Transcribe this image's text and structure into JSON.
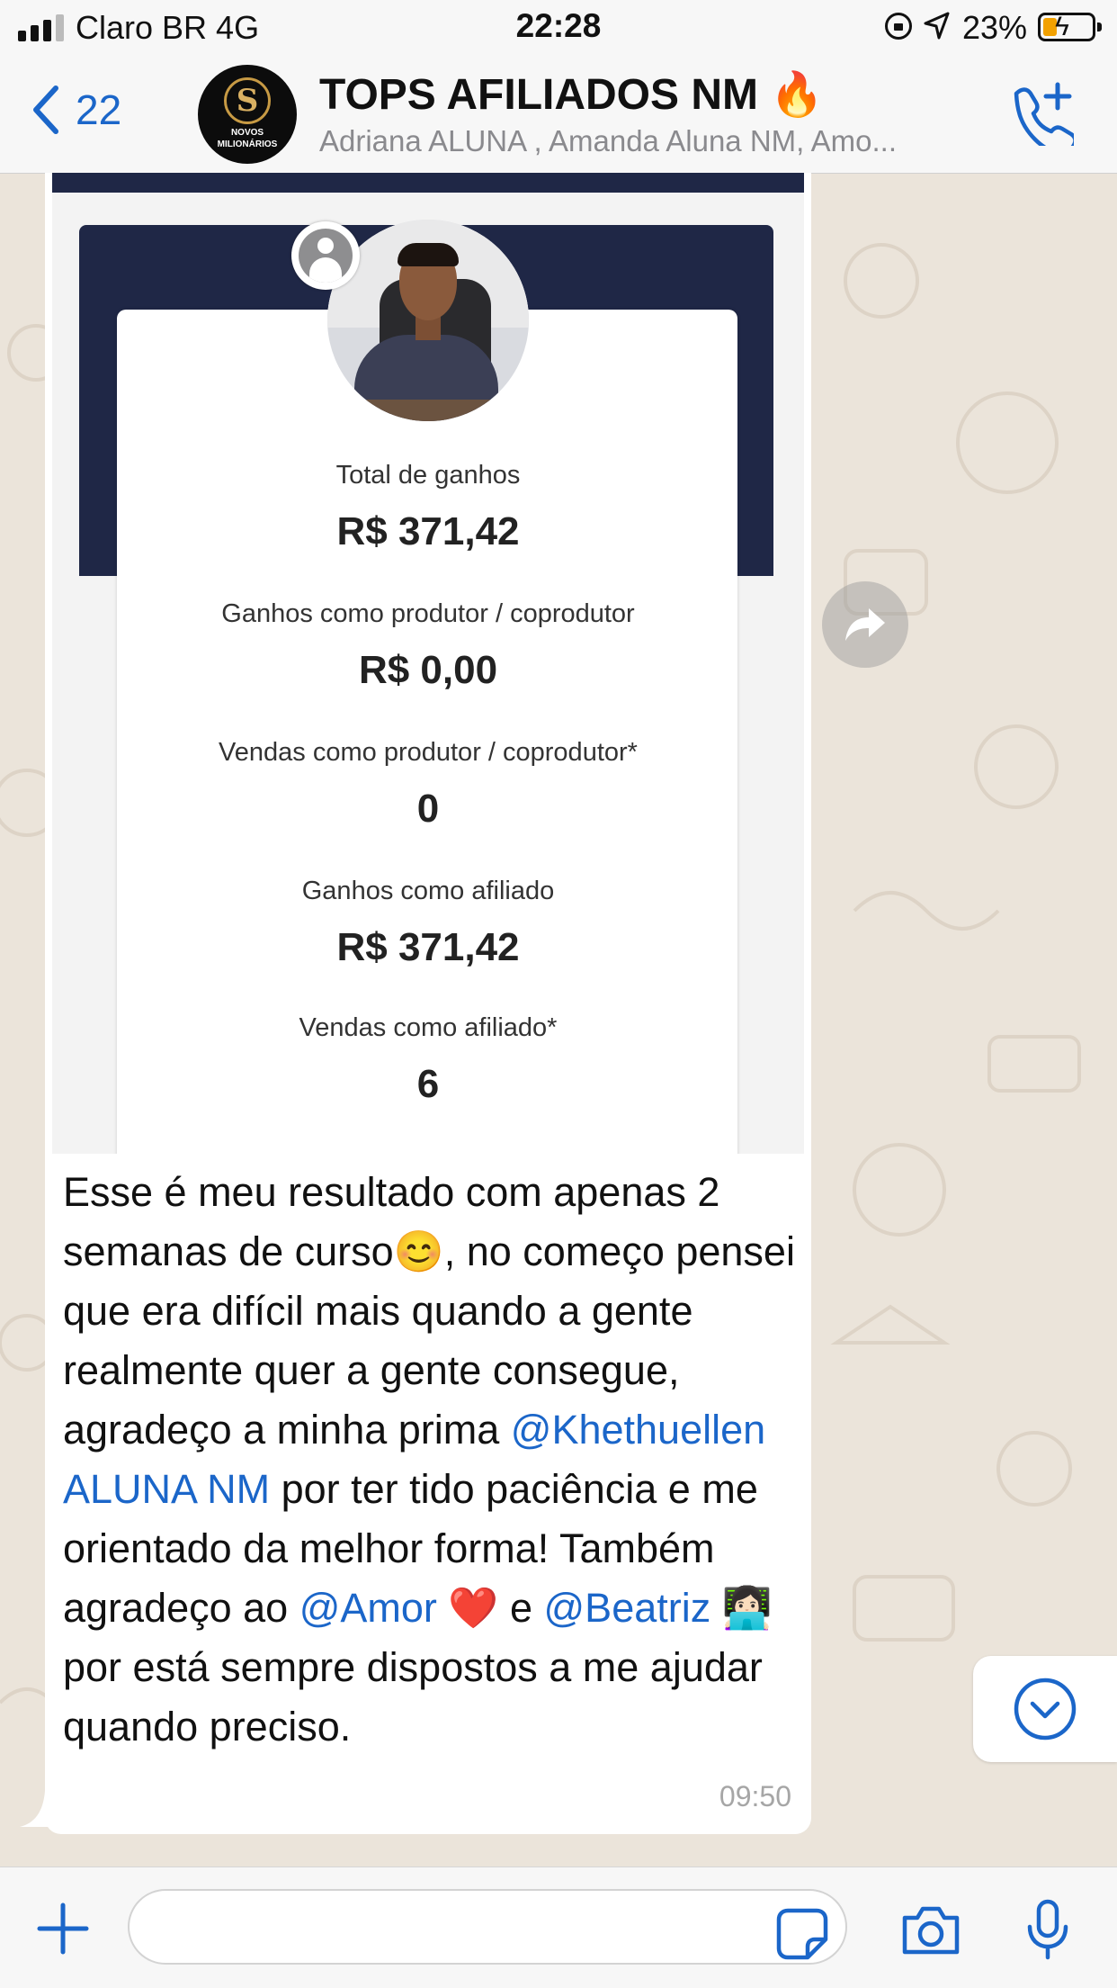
{
  "status_bar": {
    "carrier": "Claro BR   4G",
    "time": "22:28",
    "battery_pct": "23%"
  },
  "header": {
    "back_count": "22",
    "title": "TOPS AFILIADOS NM 🔥",
    "subtitle": "Adriana ALUNA , Amanda Aluna NM, Amo...",
    "avatar_text": {
      "top": "NOVOS",
      "bottom": "MILIONÁRIOS"
    }
  },
  "message": {
    "image": {
      "stats": [
        {
          "label": "Total de ganhos",
          "value": "R$ 371,42"
        },
        {
          "label": "Ganhos como produtor / coprodutor",
          "value": "R$ 0,00"
        },
        {
          "label": "Vendas como produtor / coprodutor*",
          "value": "0"
        },
        {
          "label": "Ganhos como afiliado",
          "value": "R$ 371,42"
        },
        {
          "label": "Vendas como afiliado*",
          "value": "6"
        }
      ]
    },
    "text": {
      "p1": "Esse é meu resultado com apenas 2 semanas de curso😊, no começo pensei que era difícil mais quando a gente realmente quer a gente consegue, agradeço a minha prima ",
      "mention1": "@Khethuellen ALUNA NM",
      "p2": " por ter tido paciência e me orientado da melhor forma! Também agradeço ao ",
      "mention2": "@Amor",
      "p3": " ❤️ e ",
      "mention3": "@Beatriz",
      "p4": " 👩🏻‍💻 por está sempre dispostos a me ajudar quando preciso."
    },
    "time": "09:50"
  },
  "composer": {
    "placeholder": ""
  },
  "colors": {
    "accent": "#1b66c9",
    "wallpaper": "#ebe4da",
    "navy": "#1f2746"
  }
}
